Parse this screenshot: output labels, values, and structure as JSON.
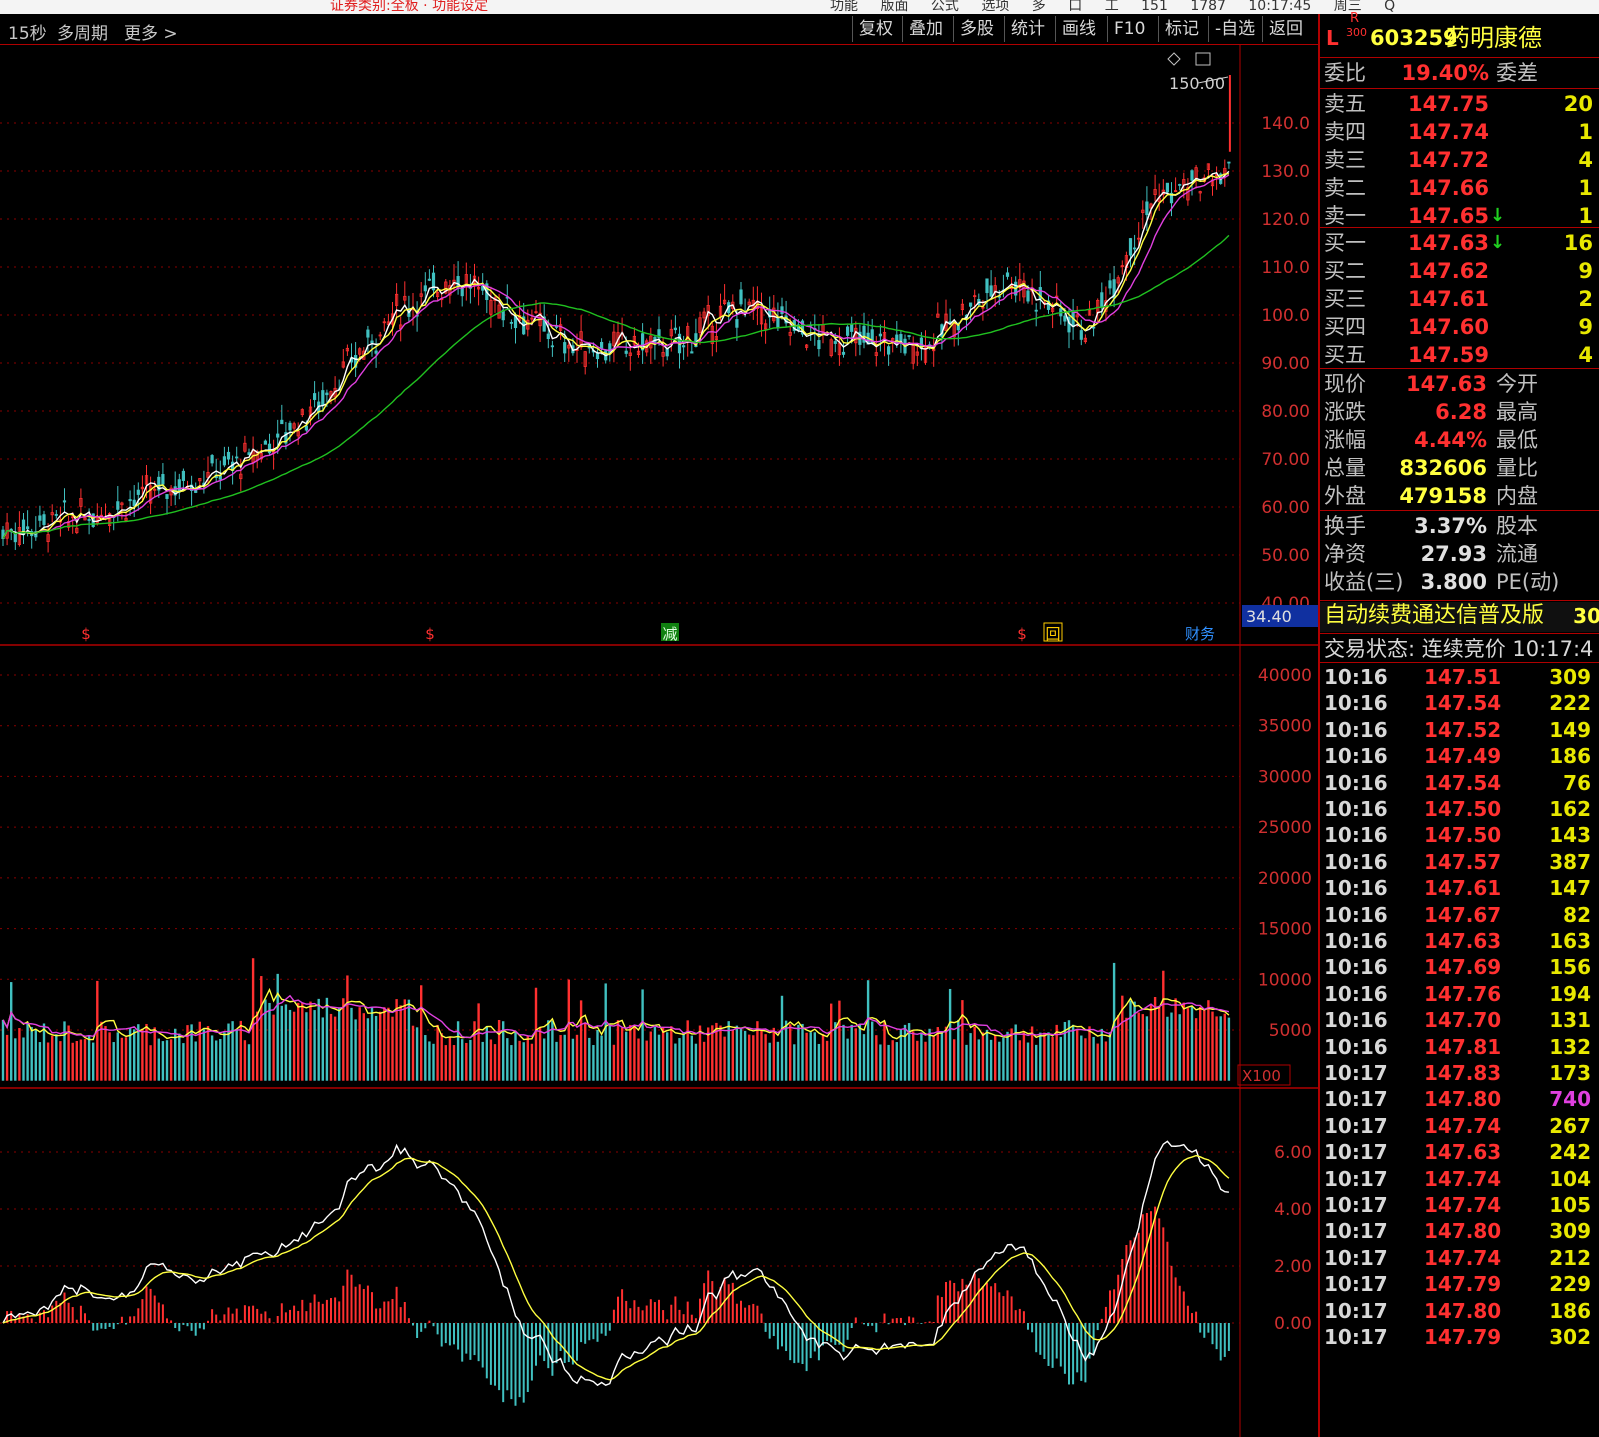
{
  "top_strip": {
    "left_text": "证券类别:全板 · 功能设定",
    "right_items": [
      "功能",
      "版面",
      "公式",
      "选项",
      "多",
      "口",
      "工",
      "151",
      "1787",
      "10:17:45 周三",
      "Q"
    ]
  },
  "toolbar": {
    "left": [
      "15秒",
      "多周期",
      "更多 >"
    ],
    "buttons": [
      "复权",
      "叠加",
      "多股",
      "统计",
      "画线",
      "F10",
      "标记",
      "-自选",
      "返回"
    ]
  },
  "price_axis": [
    "140.0",
    "130.0",
    "120.0",
    "110.0",
    "100.0",
    "90.00",
    "80.00",
    "70.00",
    "60.00",
    "50.00",
    "40.00"
  ],
  "price_max_label": "150.00",
  "price_current_tag": "34.40",
  "event_markers": [
    "$",
    "$",
    "减",
    "$",
    "回",
    "财务"
  ],
  "volume_axis": [
    "40000",
    "35000",
    "30000",
    "25000",
    "20000",
    "15000",
    "10000",
    "5000"
  ],
  "volume_unit": "X100",
  "macd_axis": [
    "6.00",
    "4.00",
    "2.00",
    "0.00"
  ],
  "colors": {
    "up": "#ff3030",
    "down": "#40c0c0",
    "ma_white": "#ffffff",
    "ma_yellow": "#ffff40",
    "ma_magenta": "#e040e0",
    "ma_green": "#20c020",
    "grid": "#8a0000",
    "axis_text": "#d03030"
  },
  "stock": {
    "prefix": "L",
    "tag_r": "R",
    "tag_300": "300",
    "code": "603259",
    "name": "药明康德",
    "wei_bi_label": "委比",
    "wei_bi": "19.40%",
    "wei_cha_label": "委差"
  },
  "asks": [
    {
      "label": "卖五",
      "price": "147.75",
      "vol": "20"
    },
    {
      "label": "卖四",
      "price": "147.74",
      "vol": "1"
    },
    {
      "label": "卖三",
      "price": "147.72",
      "vol": "4"
    },
    {
      "label": "卖二",
      "price": "147.66",
      "vol": "1"
    },
    {
      "label": "卖一",
      "price": "147.65",
      "vol": "1",
      "arrow": "↓"
    }
  ],
  "bids": [
    {
      "label": "买一",
      "price": "147.63",
      "vol": "16",
      "arrow": "↓"
    },
    {
      "label": "买二",
      "price": "147.62",
      "vol": "9"
    },
    {
      "label": "买三",
      "price": "147.61",
      "vol": "2"
    },
    {
      "label": "买四",
      "price": "147.60",
      "vol": "9"
    },
    {
      "label": "买五",
      "price": "147.59",
      "vol": "4"
    }
  ],
  "stats_a": [
    {
      "l1": "现价",
      "v": "147.63",
      "l2": "今开"
    },
    {
      "l1": "涨跌",
      "v": "6.28",
      "l2": "最高"
    },
    {
      "l1": "涨幅",
      "v": "4.44%",
      "l2": "最低"
    },
    {
      "l1": "总量",
      "v": "832606",
      "l2": "量比"
    },
    {
      "l1": "外盘",
      "v": "479158",
      "l2": "内盘"
    }
  ],
  "stats_b": [
    {
      "l1": "换手",
      "v": "3.37%",
      "l2": "股本"
    },
    {
      "l1": "净资",
      "v": "27.93",
      "l2": "流通"
    },
    {
      "l1": "收益(三)",
      "v": "3.800",
      "l2": "PE(动)"
    }
  ],
  "promo": "自动续费通达信普及版",
  "promo_right": "30",
  "status": "交易状态: 连续竞价 10:17:4",
  "ticks": [
    {
      "t": "10:16",
      "p": "147.51",
      "v": "309"
    },
    {
      "t": "10:16",
      "p": "147.54",
      "v": "222"
    },
    {
      "t": "10:16",
      "p": "147.52",
      "v": "149"
    },
    {
      "t": "10:16",
      "p": "147.49",
      "v": "186"
    },
    {
      "t": "10:16",
      "p": "147.54",
      "v": "76"
    },
    {
      "t": "10:16",
      "p": "147.50",
      "v": "162"
    },
    {
      "t": "10:16",
      "p": "147.50",
      "v": "143"
    },
    {
      "t": "10:16",
      "p": "147.57",
      "v": "387"
    },
    {
      "t": "10:16",
      "p": "147.61",
      "v": "147"
    },
    {
      "t": "10:16",
      "p": "147.67",
      "v": "82"
    },
    {
      "t": "10:16",
      "p": "147.63",
      "v": "163"
    },
    {
      "t": "10:16",
      "p": "147.69",
      "v": "156"
    },
    {
      "t": "10:16",
      "p": "147.76",
      "v": "194"
    },
    {
      "t": "10:16",
      "p": "147.70",
      "v": "131"
    },
    {
      "t": "10:16",
      "p": "147.81",
      "v": "132"
    },
    {
      "t": "10:17",
      "p": "147.83",
      "v": "173"
    },
    {
      "t": "10:17",
      "p": "147.80",
      "v": "740",
      "big": true
    },
    {
      "t": "10:17",
      "p": "147.74",
      "v": "267"
    },
    {
      "t": "10:17",
      "p": "147.63",
      "v": "242"
    },
    {
      "t": "10:17",
      "p": "147.74",
      "v": "104"
    },
    {
      "t": "10:17",
      "p": "147.74",
      "v": "105"
    },
    {
      "t": "10:17",
      "p": "147.80",
      "v": "309"
    },
    {
      "t": "10:17",
      "p": "147.74",
      "v": "212"
    },
    {
      "t": "10:17",
      "p": "147.79",
      "v": "229"
    },
    {
      "t": "10:17",
      "p": "147.80",
      "v": "186"
    },
    {
      "t": "10:17",
      "p": "147.79",
      "v": "302"
    }
  ]
}
